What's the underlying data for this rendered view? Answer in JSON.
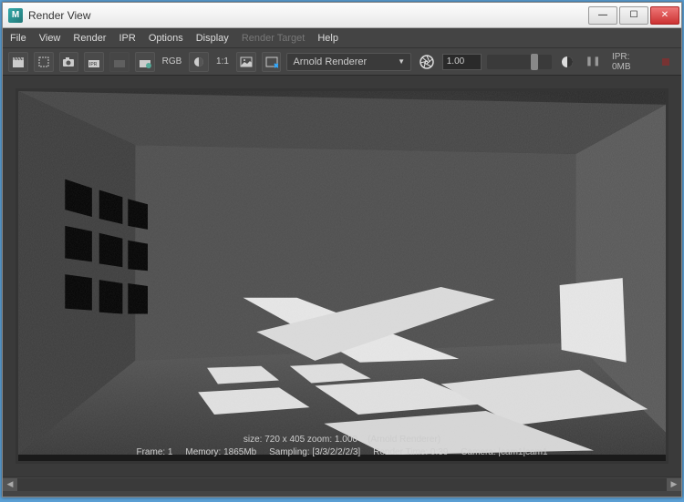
{
  "window": {
    "title": "Render View"
  },
  "menu": {
    "file": "File",
    "view": "View",
    "render": "Render",
    "ipr": "IPR",
    "options": "Options",
    "display": "Display",
    "render_target": "Render Target",
    "help": "Help"
  },
  "toolbar": {
    "rgb_label": "RGB",
    "ratio_label": "1:1",
    "renderer": "Arnold Renderer",
    "exposure_value": "1.00",
    "ipr_size": "IPR: 0MB"
  },
  "viewport": {
    "info_line1_size": "size: 720 x 405 zoom: 1.000",
    "info_line1_renderer": "(Arnold Renderer)",
    "info_line2_frame": "Frame: 1",
    "info_line2_memory": "Memory: 1865Mb",
    "info_line2_sampling": "Sampling: [3/3/2/2/2/3]",
    "info_line2_time": "Render Time: 0:39",
    "info_line2_camera": "Camera: |cam1|cam1"
  },
  "icons": {
    "minimize": "—",
    "maximize": "☐",
    "close": "✕",
    "caret": "▼",
    "left": "◀",
    "right": "▶",
    "pause": "❚❚"
  }
}
